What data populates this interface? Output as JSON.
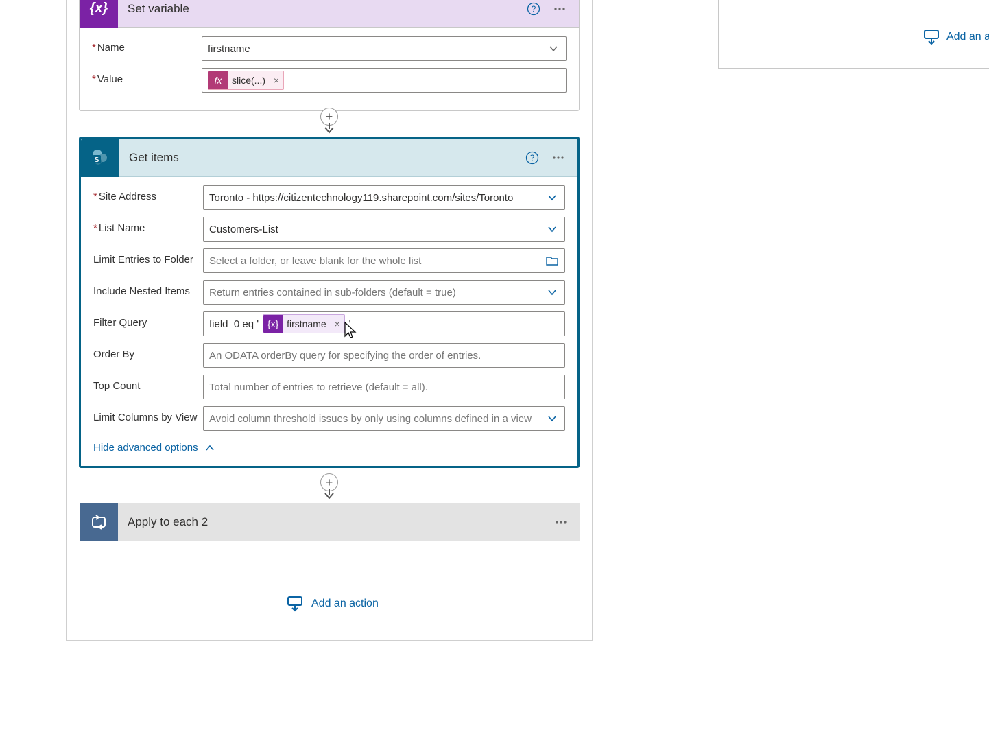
{
  "set_variable": {
    "title": "Set variable",
    "name_label": "Name",
    "name_value": "firstname",
    "value_label": "Value",
    "value_token_text": "slice(...)"
  },
  "get_items": {
    "title": "Get items",
    "site_label": "Site Address",
    "site_value": "Toronto - https://citizentechnology119.sharepoint.com/sites/Toronto",
    "list_label": "List Name",
    "list_value": "Customers-List",
    "folder_label": "Limit Entries to Folder",
    "folder_placeholder": "Select a folder, or leave blank for the whole list",
    "nested_label": "Include Nested Items",
    "nested_placeholder": "Return entries contained in sub-folders (default = true)",
    "filter_label": "Filter Query",
    "filter_prefix": "field_0 eq '",
    "filter_token_text": "firstname",
    "filter_suffix": "'",
    "orderby_label": "Order By",
    "orderby_placeholder": "An ODATA orderBy query for specifying the order of entries.",
    "top_label": "Top Count",
    "top_placeholder": "Total number of entries to retrieve (default = all).",
    "limitcols_label": "Limit Columns by View",
    "limitcols_placeholder": "Avoid column threshold issues by only using columns defined in a view",
    "hide_adv": "Hide advanced options"
  },
  "apply_each": {
    "title": "Apply to each 2"
  },
  "add_action": "Add an action",
  "add_action_short": "Add an a"
}
